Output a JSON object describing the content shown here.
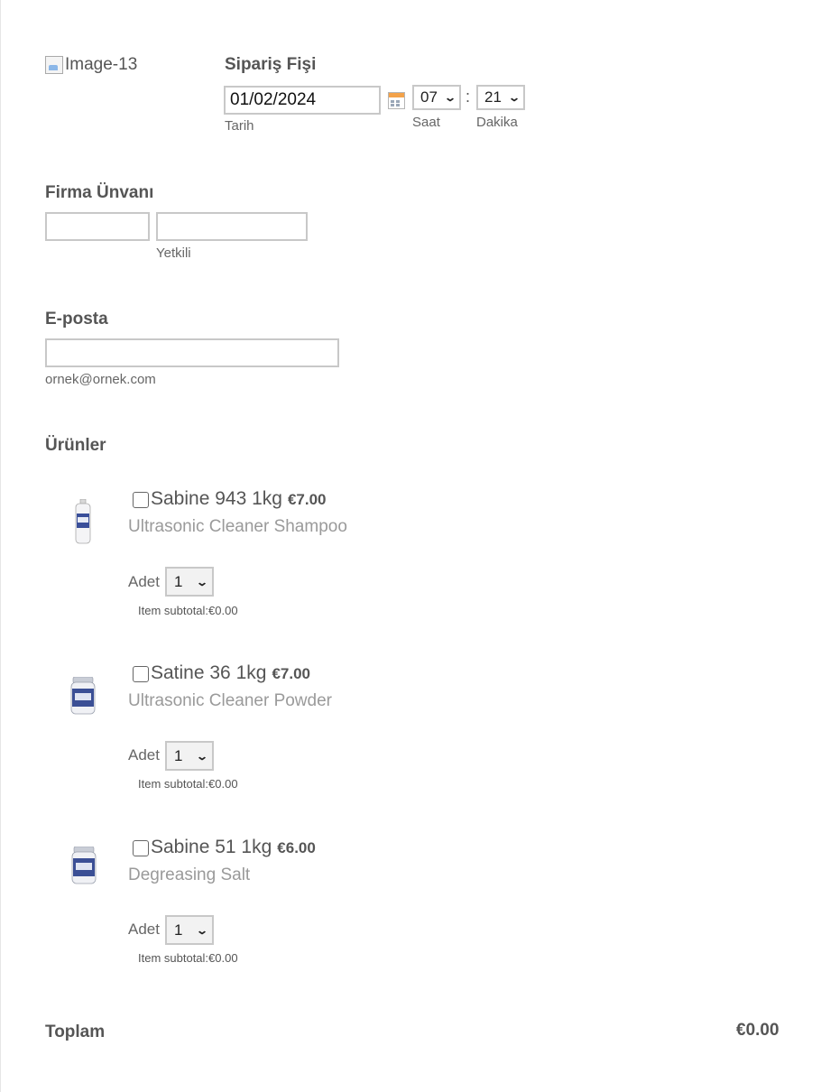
{
  "logo": {
    "alt": "Image-13"
  },
  "header": {
    "title": "Sipariş Fişi",
    "date_value": "01/02/2024",
    "date_sublabel": "Tarih",
    "hour_value": "07",
    "hour_sublabel": "Saat",
    "time_separator": ":",
    "minute_value": "21",
    "minute_sublabel": "Dakika"
  },
  "company": {
    "label": "Firma Ünvanı",
    "name_value": "",
    "contact_value": "",
    "contact_sublabel": "Yetkili"
  },
  "email": {
    "label": "E-posta",
    "value": "",
    "hint": "ornek@ornek.com"
  },
  "products": {
    "label": "Ürünler",
    "qty_label": "Adet",
    "items": [
      {
        "name": "Sabine 943 1kg",
        "price": "€7.00",
        "description": "Ultrasonic Cleaner Shampoo",
        "qty": "1",
        "subtotal": "Item subtotal:€0.00",
        "image_icon": "bottle-icon",
        "checked": false
      },
      {
        "name": "Satine 36 1kg",
        "price": "€7.00",
        "description": "Ultrasonic Cleaner Powder",
        "qty": "1",
        "subtotal": "Item subtotal:€0.00",
        "image_icon": "jar-icon",
        "checked": false
      },
      {
        "name": "Sabine 51 1kg",
        "price": "€6.00",
        "description": "Degreasing Salt",
        "qty": "1",
        "subtotal": "Item subtotal:€0.00",
        "image_icon": "jar-icon",
        "checked": false
      }
    ]
  },
  "total": {
    "label": "Toplam",
    "value": "€0.00"
  }
}
